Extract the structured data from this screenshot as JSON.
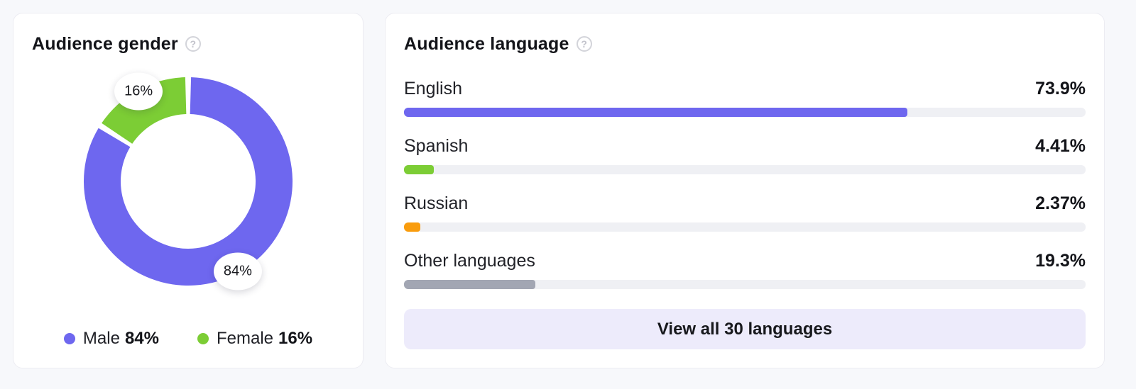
{
  "gender_card": {
    "title": "Audience gender",
    "help_icon": "?"
  },
  "language_card": {
    "title": "Audience language",
    "help_icon": "?",
    "button_label": "View all 30 languages"
  },
  "colors": {
    "accent_purple": "#6E67EF",
    "accent_green": "#7CCD35",
    "accent_orange": "#F99C0D",
    "neutral_gray": "#A2A6B3",
    "bar_track": "#EFF0F4",
    "button_bg": "#EDEBFB",
    "page_bg": "#F7F8FB"
  },
  "chart_data": [
    {
      "type": "pie",
      "subtype": "donut",
      "title": "Audience gender",
      "series": [
        {
          "name": "Male",
          "value": 84,
          "label": "84%",
          "color": "#6E67EF"
        },
        {
          "name": "Female",
          "value": 16,
          "label": "16%",
          "color": "#7CCD35"
        }
      ],
      "start_angle_deg": 0,
      "pad_angle_deg": 1.6,
      "outer_radius": 147,
      "inner_radius": 95,
      "legend_position": "bottom"
    },
    {
      "type": "bar",
      "orientation": "horizontal",
      "title": "Audience language",
      "categories": [
        "English",
        "Spanish",
        "Russian",
        "Other languages"
      ],
      "values": [
        73.9,
        4.41,
        2.37,
        19.3
      ],
      "value_labels": [
        "73.9%",
        "4.41%",
        "2.37%",
        "19.3%"
      ],
      "colors": [
        "#6E67EF",
        "#7CCD35",
        "#F99C0D",
        "#A2A6B3"
      ],
      "track_color": "#EFF0F4",
      "xlim": [
        0,
        100
      ],
      "grid": false
    }
  ]
}
